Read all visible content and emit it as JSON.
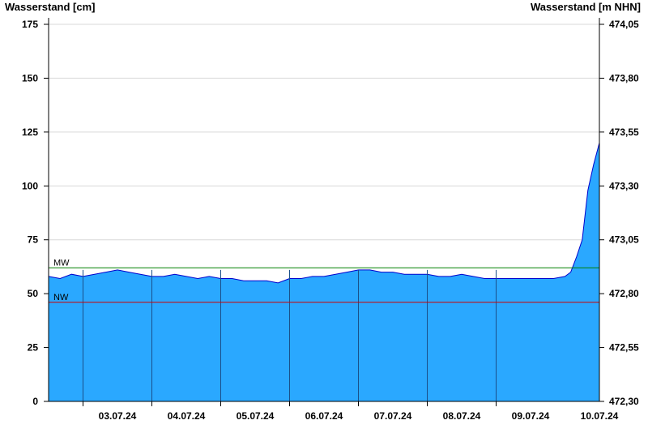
{
  "chart_data": {
    "type": "area",
    "left_axis_label": "Wasserstand [cm]",
    "right_axis_label": "Wasserstand [m NHN]",
    "ylim": [
      0,
      175
    ],
    "yticks": [
      0,
      25,
      50,
      75,
      100,
      125,
      150,
      175
    ],
    "right_ylim": [
      472.3,
      474.05
    ],
    "right_yticks": [
      "472,30",
      "472,55",
      "472,80",
      "473,05",
      "473,30",
      "473,55",
      "473,80",
      "474,05"
    ],
    "xlim": [
      "2024-07-02T20:00",
      "2024-07-10T20:00"
    ],
    "x_date_labels": [
      "03.07.24",
      "04.07.24",
      "05.07.24",
      "06.07.24",
      "07.07.24",
      "08.07.24",
      "09.07.24",
      "10.07.24"
    ],
    "x_day_boundaries": [
      "2024-07-03T08:00",
      "2024-07-04T08:00",
      "2024-07-05T08:00",
      "2024-07-06T08:00",
      "2024-07-07T08:00",
      "2024-07-08T08:00",
      "2024-07-09T08:00"
    ],
    "grid": true,
    "reference_lines": [
      {
        "label": "MW",
        "value": 62,
        "color": "#008000"
      },
      {
        "label": "NW",
        "value": 46,
        "color": "#cc0000"
      }
    ],
    "series": [
      {
        "color": "#2aa8ff",
        "line_color": "#0000cc",
        "x": [
          "2024-07-02T20:00",
          "2024-07-03T00:00",
          "2024-07-03T04:00",
          "2024-07-03T08:00",
          "2024-07-03T12:00",
          "2024-07-03T16:00",
          "2024-07-03T20:00",
          "2024-07-04T00:00",
          "2024-07-04T04:00",
          "2024-07-04T08:00",
          "2024-07-04T12:00",
          "2024-07-04T16:00",
          "2024-07-04T20:00",
          "2024-07-05T00:00",
          "2024-07-05T04:00",
          "2024-07-05T08:00",
          "2024-07-05T12:00",
          "2024-07-05T16:00",
          "2024-07-05T20:00",
          "2024-07-06T00:00",
          "2024-07-06T04:00",
          "2024-07-06T08:00",
          "2024-07-06T12:00",
          "2024-07-06T16:00",
          "2024-07-06T20:00",
          "2024-07-07T00:00",
          "2024-07-07T04:00",
          "2024-07-07T08:00",
          "2024-07-07T12:00",
          "2024-07-07T16:00",
          "2024-07-07T20:00",
          "2024-07-08T00:00",
          "2024-07-08T04:00",
          "2024-07-08T08:00",
          "2024-07-08T12:00",
          "2024-07-08T16:00",
          "2024-07-08T20:00",
          "2024-07-09T00:00",
          "2024-07-09T04:00",
          "2024-07-09T08:00",
          "2024-07-09T12:00",
          "2024-07-09T16:00",
          "2024-07-09T20:00",
          "2024-07-10T00:00",
          "2024-07-10T04:00",
          "2024-07-10T08:00",
          "2024-07-10T10:00",
          "2024-07-10T12:00",
          "2024-07-10T14:00",
          "2024-07-10T16:00",
          "2024-07-10T18:00",
          "2024-07-10T20:00"
        ],
        "values": [
          58,
          57,
          59,
          58,
          59,
          60,
          61,
          60,
          59,
          58,
          58,
          59,
          58,
          57,
          58,
          57,
          57,
          56,
          56,
          56,
          55,
          57,
          57,
          58,
          58,
          59,
          60,
          61,
          61,
          60,
          60,
          59,
          59,
          59,
          58,
          58,
          59,
          58,
          57,
          57,
          57,
          57,
          57,
          57,
          57,
          58,
          60,
          67,
          75,
          98,
          110,
          120
        ]
      }
    ]
  }
}
